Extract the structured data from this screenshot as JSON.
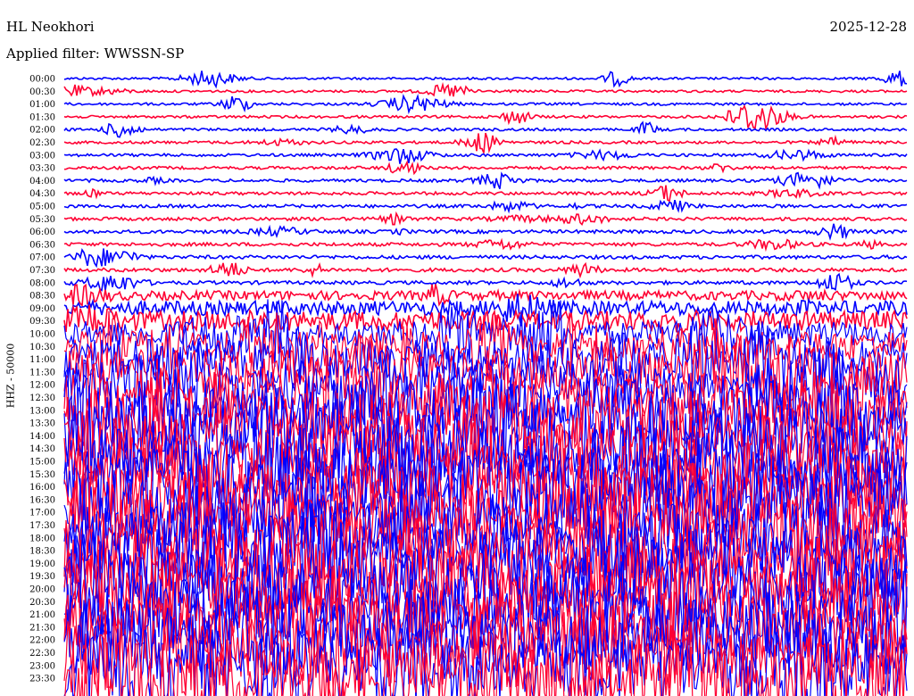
{
  "header": {
    "station": "HL Neokhori",
    "date": "2025-12-28",
    "filter": "Applied filter: WWSSN-SP"
  },
  "chart_data": {
    "type": "line",
    "title": "HL Neokhori",
    "ylabel": "HHZ - 50000",
    "grid": false,
    "colors": [
      "#0000ff",
      "#ff0033"
    ],
    "rows": [
      "00:00",
      "00:30",
      "01:00",
      "01:30",
      "02:00",
      "02:30",
      "03:00",
      "03:30",
      "04:00",
      "04:30",
      "05:00",
      "05:30",
      "06:00",
      "06:30",
      "07:00",
      "07:30",
      "08:00",
      "08:30",
      "09:00",
      "09:30",
      "10:00",
      "10:30",
      "11:00",
      "11:30",
      "12:00",
      "12:30",
      "13:00",
      "13:30",
      "14:00",
      "14:30",
      "15:00",
      "15:30",
      "16:00",
      "16:30",
      "17:00",
      "17:30",
      "18:00",
      "18:30",
      "19:00",
      "19:30",
      "20:00",
      "20:30",
      "21:00",
      "21:30",
      "22:00",
      "22:30",
      "23:00",
      "23:30"
    ]
  }
}
